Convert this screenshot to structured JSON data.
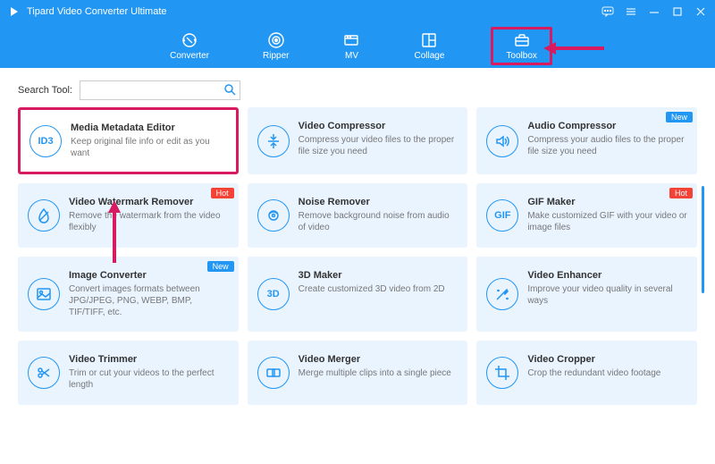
{
  "app": {
    "title": "Tipard Video Converter Ultimate"
  },
  "tabs": [
    {
      "label": "Converter"
    },
    {
      "label": "Ripper"
    },
    {
      "label": "MV"
    },
    {
      "label": "Collage"
    },
    {
      "label": "Toolbox"
    }
  ],
  "search": {
    "label": "Search Tool:",
    "value": ""
  },
  "tools": [
    {
      "icon": "ID3",
      "title": "Media Metadata Editor",
      "desc": "Keep original file info or edit as you want",
      "highlight": true
    },
    {
      "icon": "compress",
      "title": "Video Compressor",
      "desc": "Compress your video files to the proper file size you need"
    },
    {
      "icon": "audio",
      "title": "Audio Compressor",
      "desc": "Compress your audio files to the proper file size you need",
      "badge": "New"
    },
    {
      "icon": "drop",
      "title": "Video Watermark Remover",
      "desc": "Remove the watermark from the video flexibly",
      "badge": "Hot"
    },
    {
      "icon": "noise",
      "title": "Noise Remover",
      "desc": "Remove background noise from audio of video"
    },
    {
      "icon": "GIF",
      "title": "GIF Maker",
      "desc": "Make customized GIF with your video or image files",
      "badge": "Hot"
    },
    {
      "icon": "image",
      "title": "Image Converter",
      "desc": "Convert images formats between JPG/JPEG, PNG, WEBP, BMP, TIF/TIFF, etc.",
      "badge": "New"
    },
    {
      "icon": "3D",
      "title": "3D Maker",
      "desc": "Create customized 3D video from 2D"
    },
    {
      "icon": "enhance",
      "title": "Video Enhancer",
      "desc": "Improve your video quality in several ways"
    },
    {
      "icon": "trim",
      "title": "Video Trimmer",
      "desc": "Trim or cut your videos to the perfect length"
    },
    {
      "icon": "merge",
      "title": "Video Merger",
      "desc": "Merge multiple clips into a single piece"
    },
    {
      "icon": "crop",
      "title": "Video Cropper",
      "desc": "Crop the redundant video footage"
    }
  ],
  "badges": {
    "Hot": "Hot",
    "New": "New"
  }
}
